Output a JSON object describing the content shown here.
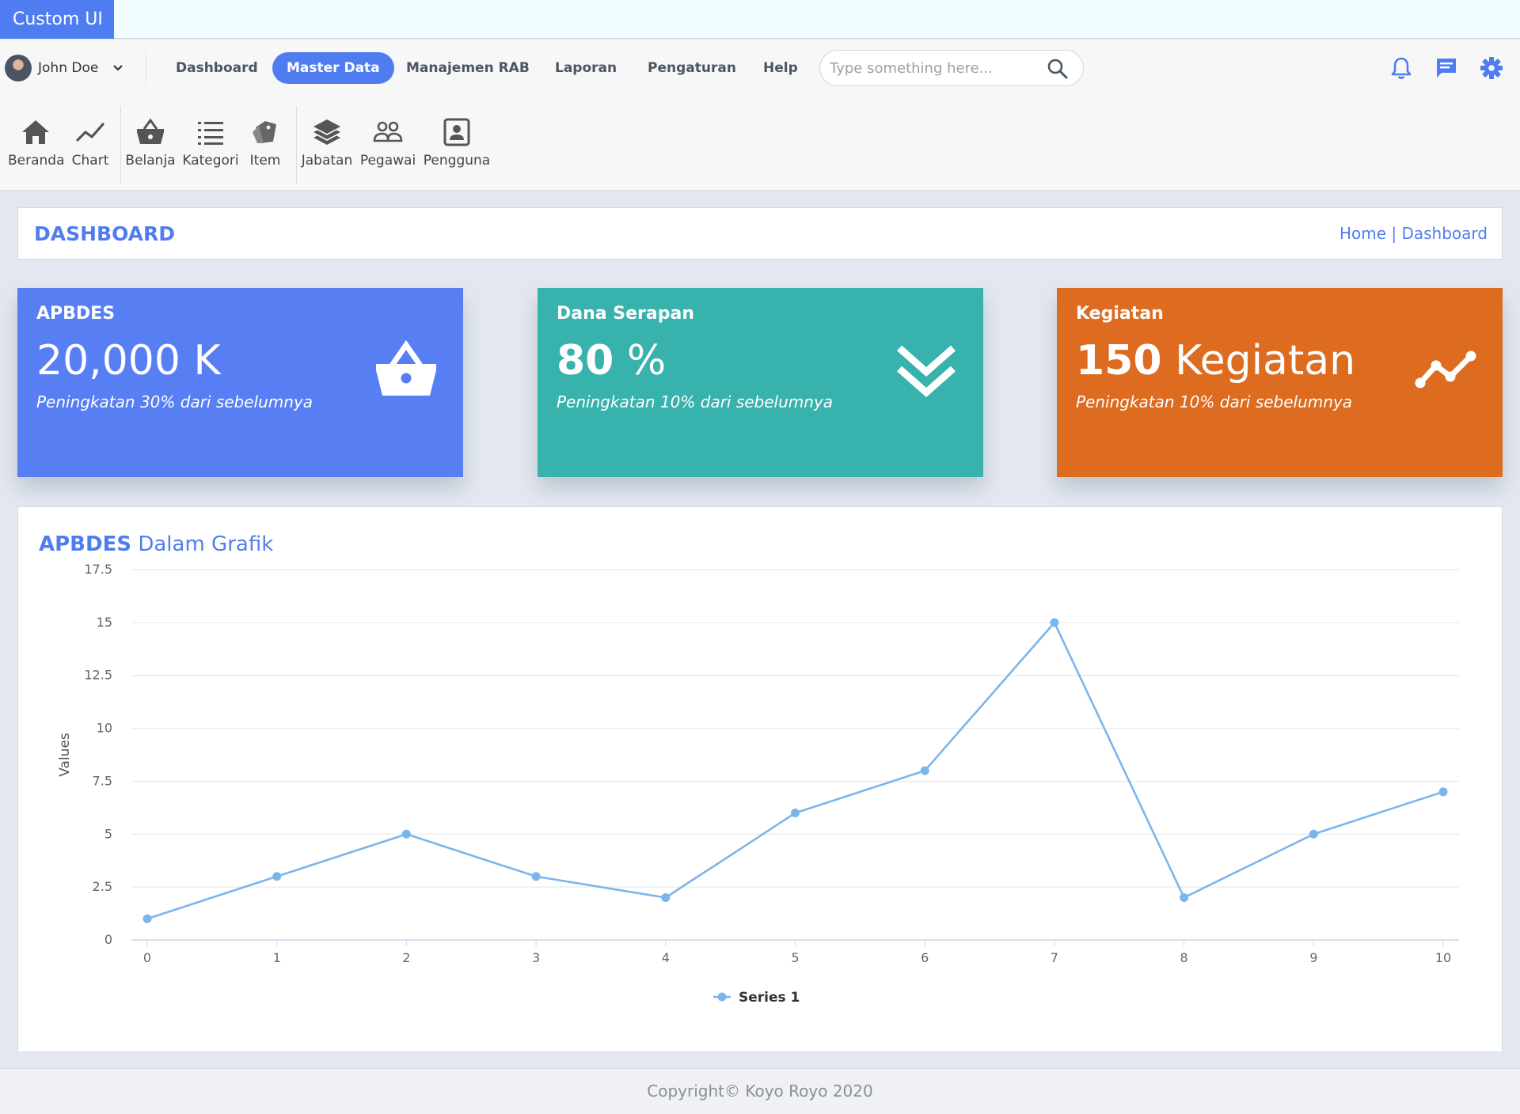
{
  "app": {
    "title": "Custom UI"
  },
  "user": {
    "name": "John Doe"
  },
  "nav": {
    "links": [
      {
        "label": "Dashboard",
        "active": false
      },
      {
        "label": "Master Data",
        "active": true
      },
      {
        "label": "Manajemen RAB",
        "active": false
      },
      {
        "label": "Laporan",
        "active": false
      },
      {
        "label": "Pengaturan",
        "active": false
      },
      {
        "label": "Help",
        "active": false
      }
    ],
    "search_placeholder": "Type something here...",
    "icons": [
      "bell-icon",
      "message-icon",
      "gear-icon"
    ]
  },
  "ribbon": {
    "items": [
      {
        "label": "Beranda",
        "icon": "home-icon"
      },
      {
        "label": "Chart",
        "icon": "line-chart-icon"
      },
      {
        "label": "Belanja",
        "icon": "basket-icon"
      },
      {
        "label": "Kategori",
        "icon": "list-icon"
      },
      {
        "label": "Item",
        "icon": "tags-icon"
      },
      {
        "label": "Jabatan",
        "icon": "layers-icon"
      },
      {
        "label": "Pegawai",
        "icon": "people-icon"
      },
      {
        "label": "Pengguna",
        "icon": "user-box-icon"
      }
    ]
  },
  "page": {
    "title": "DASHBOARD",
    "breadcrumb": {
      "home": "Home",
      "separator": " | ",
      "current": "Dashboard"
    }
  },
  "cards": [
    {
      "title": "APBDES",
      "value_strong": "",
      "value_rest": "20,000 K",
      "subtitle": "Peningkatan 30% dari sebelumnya",
      "color": "#587ef4",
      "icon": "basket-icon"
    },
    {
      "title": "Dana Serapan",
      "value_strong": "80",
      "value_rest": " %",
      "subtitle": "Peningkatan 10% dari sebelumnya",
      "color": "#38b2ac",
      "icon": "double-chevron-down-icon"
    },
    {
      "title": "Kegiatan",
      "value_strong": "150",
      "value_rest": " Kegiatan",
      "subtitle": "Peningkatan 10% dari sebelumnya",
      "color": "#dd6b20",
      "icon": "trend-icon"
    }
  ],
  "chart_section": {
    "title_strong": "APBDES",
    "title_rest": " Dalam Grafik"
  },
  "chart_data": {
    "type": "line",
    "x": [
      0,
      1,
      2,
      3,
      4,
      5,
      6,
      7,
      8,
      9,
      10
    ],
    "series": [
      {
        "name": "Series 1",
        "values": [
          1,
          3,
          5,
          3,
          2,
          6,
          8,
          15,
          2,
          5,
          7
        ]
      }
    ],
    "ylabel": "Values",
    "xlabel": "",
    "ylim": [
      0,
      17.5
    ],
    "yticks": [
      0,
      2.5,
      5,
      7.5,
      10,
      12.5,
      15,
      17.5
    ],
    "xticks": [
      0,
      1,
      2,
      3,
      4,
      5,
      6,
      7,
      8,
      9,
      10
    ],
    "grid": true,
    "legend": "bottom-center",
    "color": "#7cb5ec"
  },
  "footer": {
    "text": "Copyright© Koyo Royo 2020"
  }
}
